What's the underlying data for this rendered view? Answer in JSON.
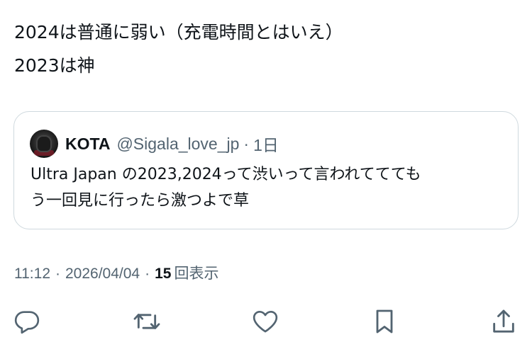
{
  "tweet": {
    "lines": [
      "2024は普通に弱い（充電時間とはいえ）",
      "2023は神"
    ]
  },
  "quote": {
    "name": "KOTA",
    "handle": "@Sigala_love_jp",
    "dot": "·",
    "time": "1日",
    "lines": [
      "Ultra Japan の2023,2024って渋いって言われててても",
      "う一回見に行ったら激つよで草"
    ]
  },
  "meta": {
    "time": "11:12",
    "sep1": "·",
    "date": "2026/04/04",
    "sep2": "·",
    "views_count": "15",
    "views_label": "回表示"
  },
  "actions": {
    "icons": [
      "reply-icon",
      "retweet-icon",
      "like-icon",
      "bookmark-icon",
      "share-icon"
    ]
  },
  "colors": {
    "text": "#0f1419",
    "secondary": "#536471",
    "border": "#cfd9de",
    "icon": "#536471"
  }
}
